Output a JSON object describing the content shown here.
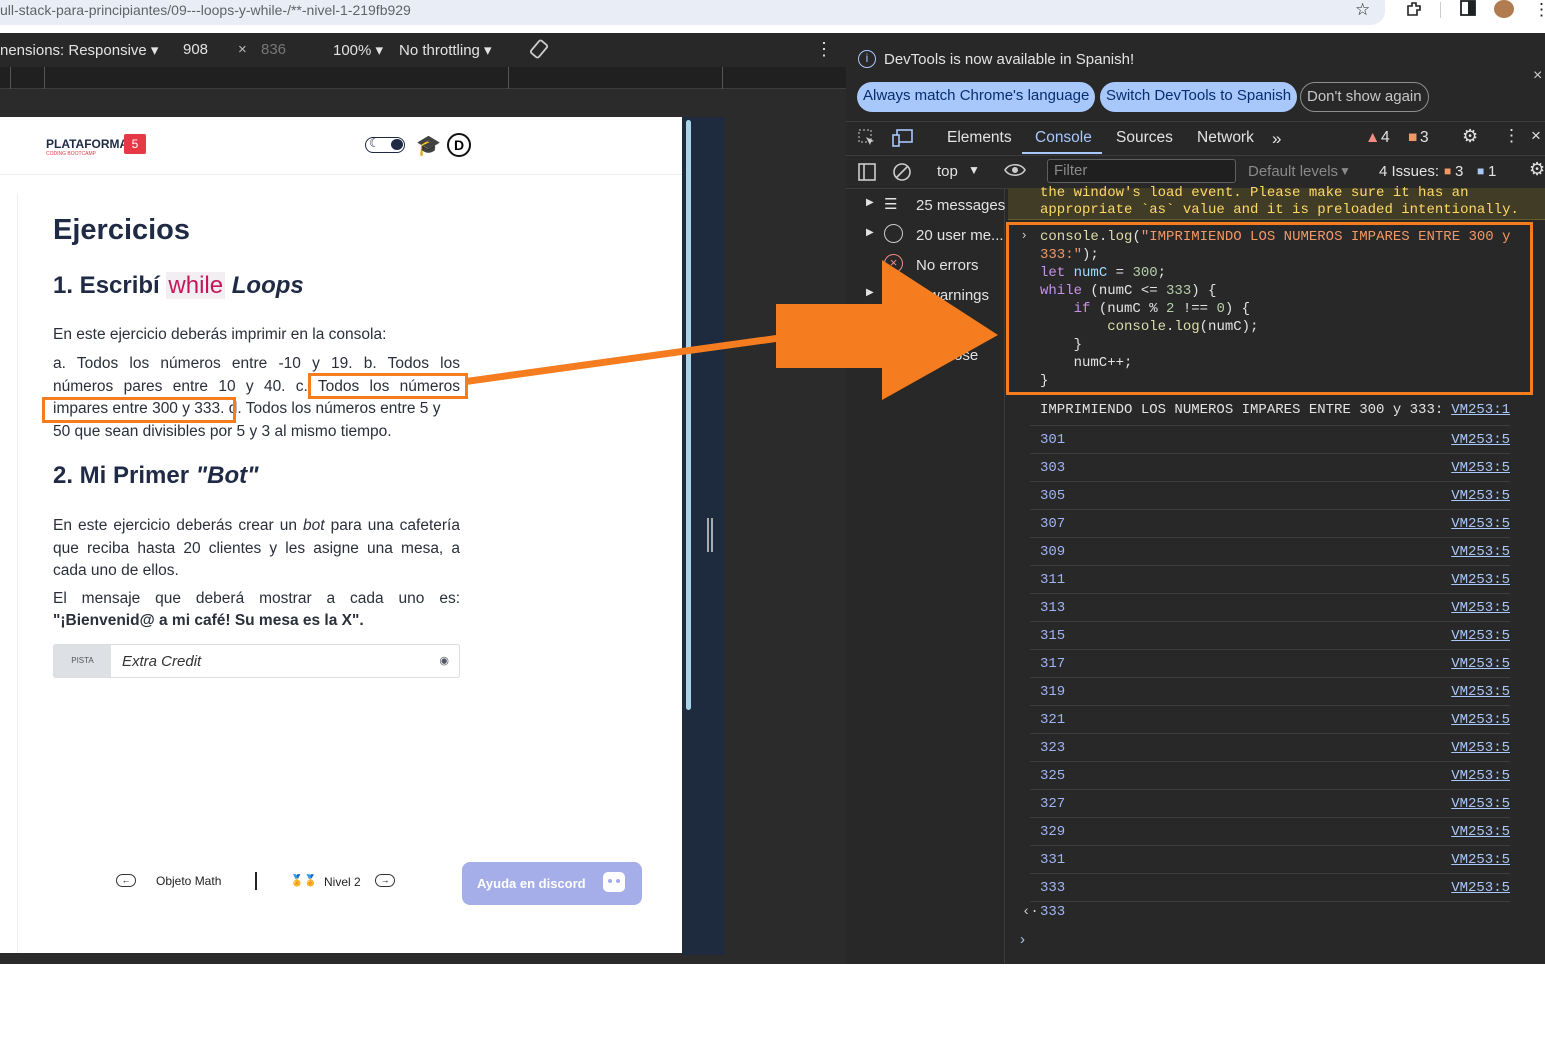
{
  "browser": {
    "url": "ull-stack-para-principiantes/09---loops-y-while-/**-nivel-1-219fb929"
  },
  "device_toolbar": {
    "dimensions": "nensions: Responsive ▾",
    "width": "908",
    "times": "×",
    "height": "836",
    "zoom": "100% ▾",
    "throttling": "No throttling ▾"
  },
  "site": {
    "logo": "PLATAFORMA",
    "logo_sub": "CODING BOOTCAMP",
    "logo_badge": "5",
    "avatar_letter": "D",
    "heading": "Ejercicios",
    "section1_prefix": "1. Escribí ",
    "section1_code": "while",
    "section1_suffix": "Loops",
    "section1_intro": "En este ejercicio deberás imprimir en la consola:",
    "section1_p_a": "a. Todos los números entre -10 y 19. b. Todos los",
    "section1_p_b1": "números pares entre 10 y 40. c. ",
    "section1_p_b2": "Todos los números",
    "section1_p_c1": "impares entre 300 y 333.",
    "section1_p_c2": " d. Todos los números entre 5 y",
    "section1_p_d": "50 que sean divisibles por 5 y 3 al mismo tiempo.",
    "section2_prefix": "2. Mi Primer ",
    "section2_em": "\"Bot\"",
    "section2_p1a": "En este ejercicio deberás crear un ",
    "section2_p1b": "bot",
    "section2_p1c": " para una cafetería",
    "section2_p2": "que reciba hasta 20 clientes y les asigne una mesa, a",
    "section2_p3": "cada uno de ellos.",
    "section2_p4": "El mensaje que deberá mostrar a cada uno es:",
    "section2_p5": "\"¡Bienvenid@ a mi café! Su mesa es la X\".",
    "hint_tag": "PISTA",
    "hint_label": "Extra Credit",
    "nav_prev": "Objeto Math",
    "nav_next": "Nivel 2",
    "discord_button": "Ayuda en discord"
  },
  "devtools": {
    "notice": "DevTools is now available in Spanish!",
    "btn_match": "Always match Chrome's language",
    "btn_switch": "Switch DevTools to Spanish",
    "btn_dismiss": "Don't show again",
    "tabs": [
      "Elements",
      "Console",
      "Sources",
      "Network"
    ],
    "warn_count": "4",
    "issue_count": "3",
    "context": "top",
    "filter_placeholder": "Filter",
    "levels": "Default levels",
    "issues_label": "4 Issues:",
    "issues_err": "3",
    "issues_info": "1",
    "sidebar": [
      {
        "label": "25 messages"
      },
      {
        "label": "20 user me..."
      },
      {
        "label": "No errors"
      },
      {
        "label": "warnings"
      },
      {
        "label": "ose"
      }
    ],
    "warning_text_1": "the window's load event. Please make sure it has an",
    "warning_text_2": "appropriate `as` value and it is preloaded intentionally.",
    "header_log": "IMPRIMIENDO LOS NUMEROS IMPARES ENTRE 300 y 333:",
    "header_src": "VM253:1",
    "values": [
      "301",
      "303",
      "305",
      "307",
      "309",
      "311",
      "313",
      "315",
      "317",
      "319",
      "321",
      "323",
      "325",
      "327",
      "329",
      "331",
      "333"
    ],
    "value_src": "VM253:5",
    "return_value": "333"
  }
}
